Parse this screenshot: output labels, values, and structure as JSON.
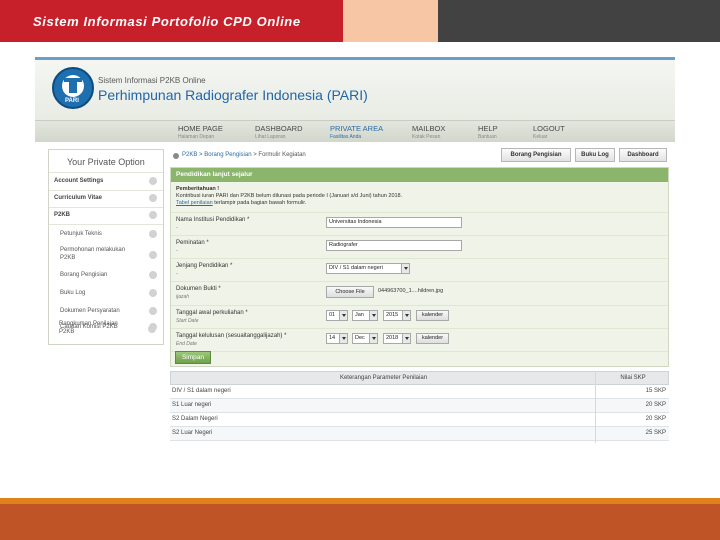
{
  "slide": {
    "title": "Sistem Informasi Portofolio CPD Online",
    "colors": {
      "red": "#c8202a",
      "peach": "#f7c6a4",
      "dark": "#424242",
      "orange": "#e0821a",
      "rust": "#bf5426"
    }
  },
  "site": {
    "logo_text": "PARI",
    "subtitle": "Sistem Informasi P2KB Online",
    "title": "Perhimpunan Radiografer Indonesia (PARI)"
  },
  "nav": [
    {
      "label": "HOME PAGE",
      "sub": "Halaman Depan"
    },
    {
      "label": "DASHBOARD",
      "sub": "Lihat Laporan"
    },
    {
      "label": "PRIVATE AREA",
      "sub": "Fasilitas Anda"
    },
    {
      "label": "MAILBOX",
      "sub": "Kotak Pesan"
    },
    {
      "label": "HELP",
      "sub": "Bantuan"
    },
    {
      "label": "LOGOUT",
      "sub": "Keluar"
    }
  ],
  "sidebar": {
    "title": "Your Private Option",
    "items": [
      {
        "label": "Account Settings"
      },
      {
        "label": "Curriculum Vitae"
      },
      {
        "label": "P2KB"
      },
      {
        "label": "Petunjuk Teknis"
      },
      {
        "label": "Permohonan melakukan",
        "label2": "P2KB"
      },
      {
        "label": "Borang Pengisian"
      },
      {
        "label": "Buku Log"
      },
      {
        "label": "Dokumen Persyaratan"
      },
      {
        "label": "Catatan Komisi P2KB"
      },
      {
        "label": "Rangkuman Penilaian",
        "label2": "P2KB"
      }
    ]
  },
  "breadcrumb": {
    "root": "P2KB",
    "sep": " > ",
    "middle": "Borang Pengisian",
    "current": "Formulir Kegiatan"
  },
  "buttons": {
    "borang": "Borang Pengisian",
    "bukulog": "Buku Log",
    "dashboard": "Dashboard"
  },
  "form": {
    "header": "Pendidikan lanjut sejalur",
    "notice_title": "Pemberitahuan !",
    "notice_body": "Kontribusi iuran PARI dan P2KB belum dilunasi pada periode I (Januari s/d Juni) tahun 2018.",
    "notice_link": "Tabel penilaian",
    "notice_tail": " terlampir pada bagian bawah formulir.",
    "fields": {
      "institusi": {
        "label": "Nama Institusi Pendidikan *",
        "sub": "-",
        "value": "Universitas Indonesia"
      },
      "peminatan": {
        "label": "Peminatan *",
        "sub": "-",
        "value": "Radiografer"
      },
      "jenjang": {
        "label": "Jenjang Pendidikan *",
        "sub": "-",
        "value": "DIV / S1 dalam negeri"
      },
      "dokumen": {
        "label": "Dokumen Bukti *",
        "sub": "ijazah",
        "button": "Choose File",
        "file": "044963700_1....hildren.jpg"
      },
      "start": {
        "label": "Tanggal awal perkuliahan *",
        "sub": "Start Date",
        "day": "01",
        "month": "Jan",
        "year": "2015",
        "button": "kalender"
      },
      "end": {
        "label": "Tanggal kelulusan (sesuaitanggalijazah) *",
        "sub": "End Date",
        "day": "14",
        "month": "Dec",
        "year": "2018",
        "button": "kalender"
      }
    },
    "submit": "Simpan"
  },
  "param_table": {
    "headers": [
      "Keterangan Parameter Penilaian",
      "Nilai SKP"
    ],
    "rows": [
      {
        "desc": "DIV / S1 dalam negeri",
        "skp": "15 SKP"
      },
      {
        "desc": "S1 Luar negeri",
        "skp": "20 SKP"
      },
      {
        "desc": "S2 Dalam Negeri",
        "skp": "20 SKP"
      },
      {
        "desc": "S2 Luar Negeri",
        "skp": "25 SKP"
      }
    ]
  }
}
